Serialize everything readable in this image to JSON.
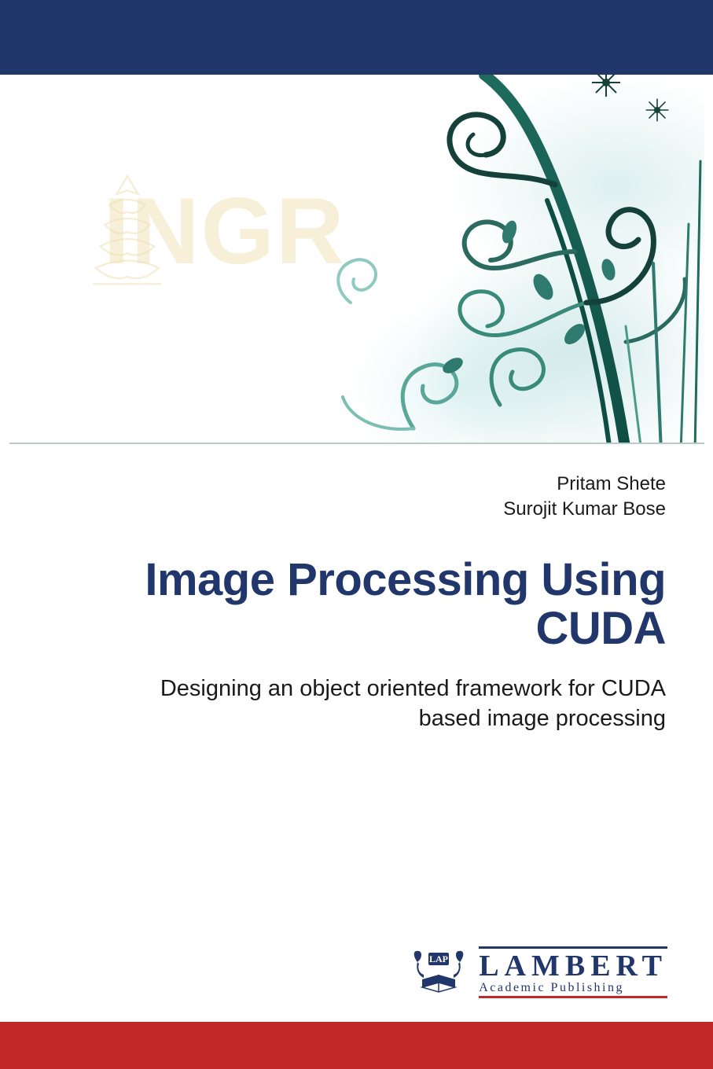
{
  "authors": [
    "Pritam Shete",
    "Surojit Kumar Bose"
  ],
  "title_line1": "Image Processing Using",
  "title_line2": "CUDA",
  "subtitle_line1": "Designing an object oriented framework for CUDA",
  "subtitle_line2": "based image processing",
  "watermark_text": "INGR",
  "publisher": {
    "badge": "LAP",
    "name": "LAMBERT",
    "sub": "Academic Publishing"
  },
  "colors": {
    "navy": "#21376b",
    "red": "#c22828",
    "teal": "#2f7a6e"
  }
}
